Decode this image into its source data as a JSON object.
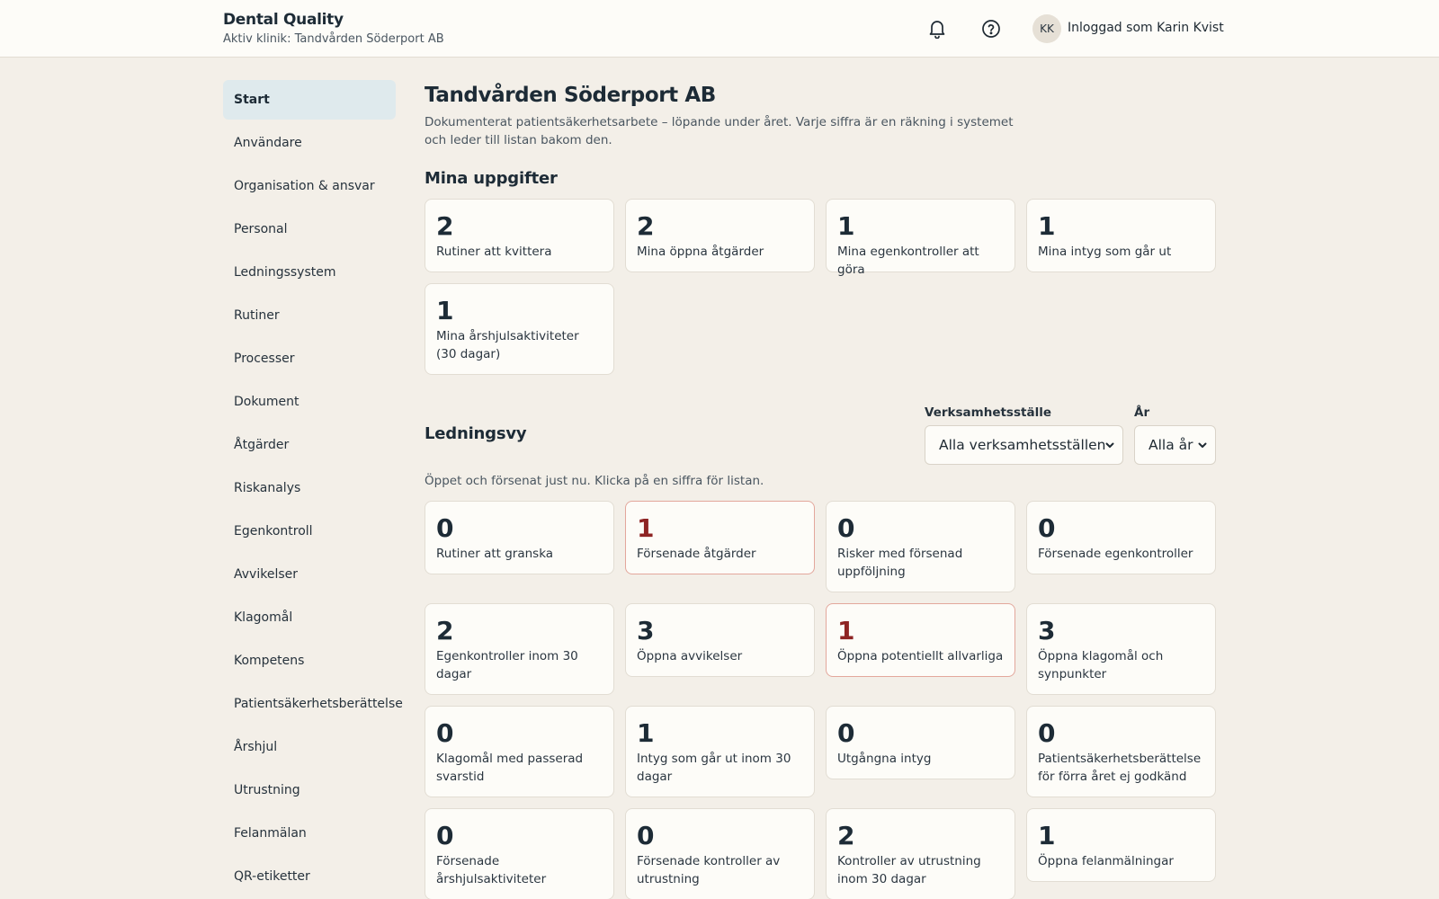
{
  "header": {
    "brand_title": "Dental Quality",
    "brand_sub": "Aktiv klinik: Tandvården Söderport AB",
    "avatar_initials": "KK",
    "user_label": "Inloggad som Karin Kvist"
  },
  "sidebar": {
    "items": [
      {
        "label": "Start",
        "active": true
      },
      {
        "label": "Användare"
      },
      {
        "label": "Organisation & ansvar"
      },
      {
        "label": "Personal"
      },
      {
        "label": "Ledningssystem"
      },
      {
        "label": "Rutiner"
      },
      {
        "label": "Processer"
      },
      {
        "label": "Dokument"
      },
      {
        "label": "Åtgärder"
      },
      {
        "label": "Riskanalys"
      },
      {
        "label": "Egenkontroll"
      },
      {
        "label": "Avvikelser"
      },
      {
        "label": "Klagomål"
      },
      {
        "label": "Kompetens"
      },
      {
        "label": "Patientsäkerhetsberättelse"
      },
      {
        "label": "Årshjul"
      },
      {
        "label": "Utrustning"
      },
      {
        "label": "Felanmälan"
      },
      {
        "label": "QR-etiketter"
      }
    ]
  },
  "main": {
    "title": "Tandvården Söderport AB",
    "description": "Dokumenterat patientsäkerhetsarbete – löpande under året. Varje siffra är en räkning i systemet och leder till listan bakom den.",
    "tasks": {
      "title": "Mina uppgifter",
      "cards": [
        {
          "num": "2",
          "label": "Rutiner att kvittera"
        },
        {
          "num": "2",
          "label": "Mina öppna åtgärder"
        },
        {
          "num": "1",
          "label": "Mina egenkontroller att göra"
        },
        {
          "num": "1",
          "label": "Mina intyg som går ut"
        },
        {
          "num": "1",
          "label": "Mina årshjulsaktiviteter (30 dagar)"
        }
      ]
    },
    "management": {
      "title": "Ledningsvy",
      "site_label": "Verksamhetsställe",
      "site_value": "Alla verksamhetsställen",
      "year_label": "År",
      "year_value": "Alla år",
      "description": "Öppet och försenat just nu. Klicka på en siffra för listan.",
      "alert_color": "#8e2424",
      "cards": [
        {
          "num": "0",
          "label": "Rutiner att granska"
        },
        {
          "num": "1",
          "label": "Försenade åtgärder",
          "alert": true
        },
        {
          "num": "0",
          "label": "Risker med försenad uppföljning"
        },
        {
          "num": "0",
          "label": "Försenade egenkontroller"
        },
        {
          "num": "2",
          "label": "Egenkontroller inom 30 dagar"
        },
        {
          "num": "3",
          "label": "Öppna avvikelser"
        },
        {
          "num": "1",
          "label": "Öppna potentiellt allvarliga",
          "alert": true
        },
        {
          "num": "3",
          "label": "Öppna klagomål och synpunkter"
        },
        {
          "num": "0",
          "label": "Klagomål med passerad svarstid"
        },
        {
          "num": "1",
          "label": "Intyg som går ut inom 30 dagar"
        },
        {
          "num": "0",
          "label": "Utgångna intyg"
        },
        {
          "num": "0",
          "label": "Patientsäkerhetsberättelse för förra året ej godkänd"
        },
        {
          "num": "0",
          "label": "Försenade årshjulsaktiviteter"
        },
        {
          "num": "0",
          "label": "Försenade kontroller av utrustning"
        },
        {
          "num": "2",
          "label": "Kontroller av utrustning inom 30 dagar"
        },
        {
          "num": "1",
          "label": "Öppna felanmälningar"
        }
      ]
    }
  }
}
